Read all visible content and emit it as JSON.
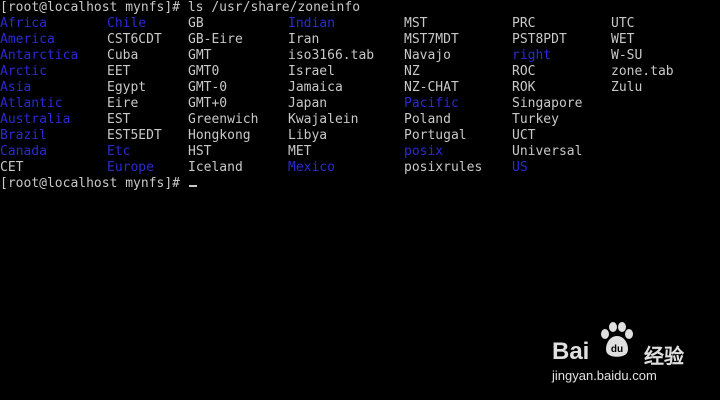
{
  "terminal": {
    "command_line": "[root@localhost mynfs]# ls /usr/share/zoneinfo",
    "prompt": "[root@localhost mynfs]# ",
    "colors": {
      "background": "#000000",
      "text": "#c8c8c8",
      "directory": "#2a2ad4"
    },
    "columns": [
      [
        {
          "name": "Africa",
          "type": "dir"
        },
        {
          "name": "America",
          "type": "dir"
        },
        {
          "name": "Antarctica",
          "type": "dir"
        },
        {
          "name": "Arctic",
          "type": "dir"
        },
        {
          "name": "Asia",
          "type": "dir"
        },
        {
          "name": "Atlantic",
          "type": "dir"
        },
        {
          "name": "Australia",
          "type": "dir"
        },
        {
          "name": "Brazil",
          "type": "dir"
        },
        {
          "name": "Canada",
          "type": "dir"
        },
        {
          "name": "CET",
          "type": "file"
        }
      ],
      [
        {
          "name": "Chile",
          "type": "dir"
        },
        {
          "name": "CST6CDT",
          "type": "file"
        },
        {
          "name": "Cuba",
          "type": "file"
        },
        {
          "name": "EET",
          "type": "file"
        },
        {
          "name": "Egypt",
          "type": "file"
        },
        {
          "name": "Eire",
          "type": "file"
        },
        {
          "name": "EST",
          "type": "file"
        },
        {
          "name": "EST5EDT",
          "type": "file"
        },
        {
          "name": "Etc",
          "type": "dir"
        },
        {
          "name": "Europe",
          "type": "dir"
        }
      ],
      [
        {
          "name": "GB",
          "type": "file"
        },
        {
          "name": "GB-Eire",
          "type": "file"
        },
        {
          "name": "GMT",
          "type": "file"
        },
        {
          "name": "GMT0",
          "type": "file"
        },
        {
          "name": "GMT-0",
          "type": "file"
        },
        {
          "name": "GMT+0",
          "type": "file"
        },
        {
          "name": "Greenwich",
          "type": "file"
        },
        {
          "name": "Hongkong",
          "type": "file"
        },
        {
          "name": "HST",
          "type": "file"
        },
        {
          "name": "Iceland",
          "type": "file"
        }
      ],
      [
        {
          "name": "Indian",
          "type": "dir"
        },
        {
          "name": "Iran",
          "type": "file"
        },
        {
          "name": "iso3166.tab",
          "type": "file"
        },
        {
          "name": "Israel",
          "type": "file"
        },
        {
          "name": "Jamaica",
          "type": "file"
        },
        {
          "name": "Japan",
          "type": "file"
        },
        {
          "name": "Kwajalein",
          "type": "file"
        },
        {
          "name": "Libya",
          "type": "file"
        },
        {
          "name": "MET",
          "type": "file"
        },
        {
          "name": "Mexico",
          "type": "dir"
        }
      ],
      [
        {
          "name": "MST",
          "type": "file"
        },
        {
          "name": "MST7MDT",
          "type": "file"
        },
        {
          "name": "Navajo",
          "type": "file"
        },
        {
          "name": "NZ",
          "type": "file"
        },
        {
          "name": "NZ-CHAT",
          "type": "file"
        },
        {
          "name": "Pacific",
          "type": "dir"
        },
        {
          "name": "Poland",
          "type": "file"
        },
        {
          "name": "Portugal",
          "type": "file"
        },
        {
          "name": "posix",
          "type": "dir"
        },
        {
          "name": "posixrules",
          "type": "file"
        }
      ],
      [
        {
          "name": "PRC",
          "type": "file"
        },
        {
          "name": "PST8PDT",
          "type": "file"
        },
        {
          "name": "right",
          "type": "dir"
        },
        {
          "name": "ROC",
          "type": "file"
        },
        {
          "name": "ROK",
          "type": "file"
        },
        {
          "name": "Singapore",
          "type": "file"
        },
        {
          "name": "Turkey",
          "type": "file"
        },
        {
          "name": "UCT",
          "type": "file"
        },
        {
          "name": "Universal",
          "type": "file"
        },
        {
          "name": "US",
          "type": "dir"
        }
      ],
      [
        {
          "name": "UTC",
          "type": "file"
        },
        {
          "name": "WET",
          "type": "file"
        },
        {
          "name": "W-SU",
          "type": "file"
        },
        {
          "name": "zone.tab",
          "type": "file"
        },
        {
          "name": "Zulu",
          "type": "file"
        }
      ]
    ]
  },
  "watermark": {
    "logo_left": "Bai",
    "logo_right": "du",
    "logo_cn": "经验",
    "url": "jingyan.baidu.com",
    "icon": "baidu-paw-icon"
  }
}
